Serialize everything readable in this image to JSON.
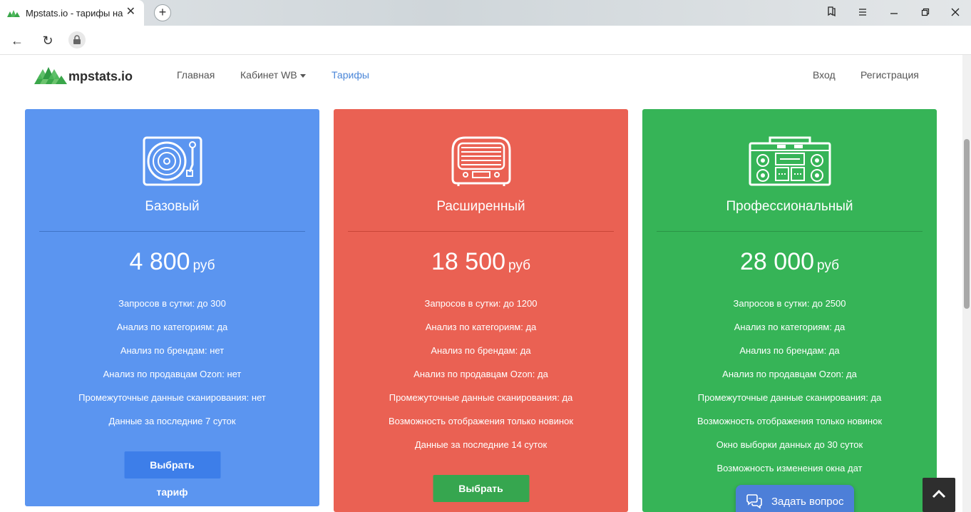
{
  "browser": {
    "tab_title": "Mpstats.io - тарифы на",
    "tab_close": "✕",
    "new_tab": "+",
    "back": "←",
    "reload": "↻"
  },
  "header": {
    "logo_text": "mpstats.io",
    "nav": {
      "home": "Главная",
      "cabinet": "Кабинет WB",
      "tariffs": "Тарифы",
      "login": "Вход",
      "register": "Регистрация"
    }
  },
  "colors": {
    "basic": "#5b95f0",
    "extended": "#ea6153",
    "professional": "#36b457",
    "active_link": "#4a86d8"
  },
  "plans": {
    "basic": {
      "icon": "turntable-icon",
      "title": "Базовый",
      "price": "4 800",
      "unit": "руб",
      "features": [
        "Запросов в сутки: до 300",
        "Анализ по категориям: да",
        "Анализ по брендам: нет",
        "Анализ по продавцам Ozon: нет",
        "Промежуточные данные сканирования: нет",
        "Данные за последние 7 суток"
      ],
      "button": "Выбрать тариф"
    },
    "extended": {
      "icon": "radio-icon",
      "title": "Расширенный",
      "price": "18 500",
      "unit": "руб",
      "features": [
        "Запросов в сутки: до 1200",
        "Анализ по категориям: да",
        "Анализ по брендам: да",
        "Анализ по продавцам Ozon: да",
        "Промежуточные данные сканирования: да",
        "Возможность отображения только новинок",
        "Данные за последние 14 суток"
      ],
      "button": "Выбрать тариф"
    },
    "professional": {
      "icon": "boombox-icon",
      "title": "Профессиональный",
      "price": "28 000",
      "unit": "руб",
      "features": [
        "Запросов в сутки: до 2500",
        "Анализ по категориям: да",
        "Анализ по брендам: да",
        "Анализ по продавцам Ozon: да",
        "Промежуточные данные сканирования: да",
        "Возможность отображения только новинок",
        "Окно выборки данных до 30 суток",
        "Возможность изменения окна дат"
      ]
    }
  },
  "widgets": {
    "ask_question": "Задать вопрос"
  }
}
